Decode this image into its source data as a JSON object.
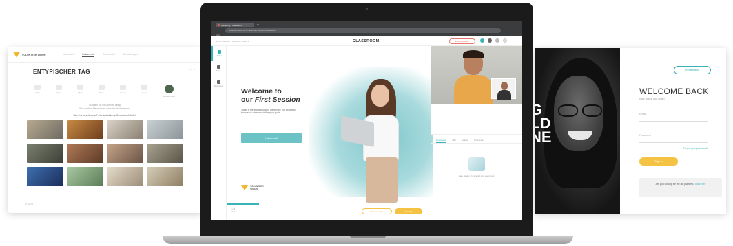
{
  "left_panel": {
    "logo_text": "VOLUNTEER VISION",
    "nav": [
      "Übersicht",
      "Dokumente",
      "Community",
      "Einstellungen"
    ],
    "nav_active_index": 1,
    "title": "ENTYPISCHER TAG",
    "icon_labels": [
      "Kultur",
      "Sport",
      "Eltern",
      "Musik",
      "Reisen",
      "Natur",
      "Nach der Arbeit"
    ],
    "note_line1": "Erzählen Sie Ihr Leben im Alltag",
    "note_line2": "Was machen Sie an einem normalen Wochenende?",
    "subtitle": "Was sind verschiedene Freizeitaktivitäten in Deutschland/Berlin?",
    "footer": "© 2022"
  },
  "right_panel": {
    "register_label": "Registration",
    "title": "WELCOME BACK",
    "tagline": "Nice to see you again",
    "email_placeholder": "Email",
    "password_placeholder": "Password",
    "forgot_label": "Forgot your password?",
    "signin_label": "Sign in",
    "old_platform_text": "Are you looking for the old platform?",
    "old_platform_link": "Click here",
    "photo_text": "G\nLD\nNE"
  },
  "laptop": {
    "browser": {
      "tab_title": "Mentoring · Classroom",
      "new_tab": "+",
      "address": "volunteervision.com/classroom/session/first-session",
      "apps_label": "Apps"
    },
    "app": {
      "breadcrumb": "Home  ›  Session  ›  Welcome  ›  Slide 1",
      "brand": "CLASSROOM",
      "leave_label": "Leave session"
    },
    "side_nav": [
      "Slides",
      "Notes",
      "Documents"
    ],
    "slide": {
      "title_line1": "Welcome to",
      "title_line2_plain": "our ",
      "title_line2_em": "First Session",
      "description": "Today is the first day of your mentoring! You will get to know each other and define your goals.",
      "button_label": "Let's start!",
      "logo_text": "VOLUNTEER VISION"
    },
    "progress": {
      "page": "1 / 6",
      "page_caption": "Slides",
      "fraction": 0.16,
      "prev_label": "Previous slide",
      "next_label": "Next slide"
    },
    "panel_tabs": [
      "Documents",
      "Wiki",
      "Notizen",
      "Übersetzer"
    ],
    "panel_note": "Here design the shared and useful tool"
  }
}
